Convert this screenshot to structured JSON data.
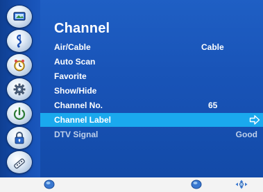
{
  "menu": {
    "title": "Channel",
    "items": [
      {
        "label": "Air/Cable",
        "value": "Cable"
      },
      {
        "label": "Auto Scan",
        "value": ""
      },
      {
        "label": "Favorite",
        "value": ""
      },
      {
        "label": "Show/Hide",
        "value": ""
      },
      {
        "label": "Channel No.",
        "value": "65"
      },
      {
        "label": "Channel Label",
        "value": ""
      },
      {
        "label": "DTV Signal",
        "value": "Good"
      }
    ]
  },
  "sidebar": {
    "icons": [
      "picture-icon",
      "audio-icon",
      "time-icon",
      "setup-icon",
      "input-icon",
      "lock-icon",
      "channel-icon"
    ]
  },
  "footer": {
    "icons": [
      "menu-button-icon",
      "enter-button-icon",
      "navigate-icon"
    ]
  },
  "colors": {
    "osd_background": "#1954b8",
    "selected_row": "#1aa9ee",
    "footer_background": "#f3f3f3"
  }
}
